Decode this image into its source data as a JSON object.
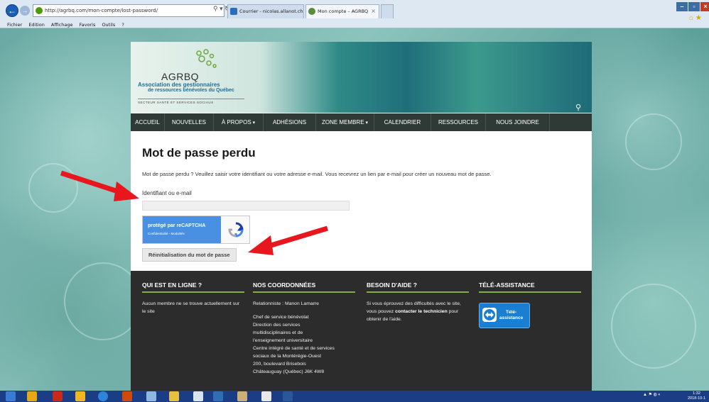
{
  "browser": {
    "url": "http://agrbq.com/mon-compte/lost-password/",
    "tabs": [
      {
        "label": "Courrier - nicolas.allanot.chu..."
      },
      {
        "label": "Mon compte – AGRBQ",
        "close": "×"
      }
    ],
    "menu": [
      "Fichier",
      "Edition",
      "Affichage",
      "Favoris",
      "Outils",
      "?"
    ]
  },
  "site": {
    "logo_text": "AGRBQ",
    "logo_sub1": "Association des gestionnaires",
    "logo_sub2": "de ressources bénévoles du Québec",
    "logo_sub3": "SECTEUR SANTÉ ET SERVICES SOCIAUX",
    "nav": [
      {
        "label": "ACCUEIL"
      },
      {
        "label": "NOUVELLES"
      },
      {
        "label": "À PROPOS"
      },
      {
        "label": "ADHÉSIONS"
      },
      {
        "label": "ZONE MEMBRE"
      },
      {
        "label": "CALENDRIER"
      },
      {
        "label": "RESSOURCES"
      },
      {
        "label": "NOUS JOINDRE"
      }
    ]
  },
  "main": {
    "title": "Mot de passe perdu",
    "intro": "Mot de passe perdu ? Veuillez saisir votre identifiant ou votre adresse e-mail. Vous recevrez un lien par e-mail pour créer un nouveau mot de passe.",
    "field_label": "Identifiant ou e-mail",
    "field_value": "",
    "recaptcha_line1": "protégé par reCAPTCHA",
    "recaptcha_line2": "Confidentialité - Modalités",
    "reset_button": "Réinitialisation du mot de passe"
  },
  "footer": {
    "col1": {
      "title": "QUI EST EN LIGNE ?",
      "text": "Aucun membre ne se trouve actuellement sur le site"
    },
    "col2": {
      "title": "NOS COORDONNÉES",
      "line1": "Relationniste : Manon Lamarre",
      "lines": [
        "Chef de service bénévolat",
        "Direction des services",
        "multidisciplinaires et de",
        "l'enseignement universitaire",
        "Centre intégré de santé et de services",
        "sociaux de la Montérégie-Ouest",
        "200, boulevard Brisebois",
        "Châteauguay (Québec) J6K 4W8"
      ]
    },
    "col3": {
      "title": "BESOIN D'AIDE ?",
      "text_pre": "Si vous éprouvez des difficultés avec le site, vous pouvez ",
      "text_bold": "contacter le technicien",
      "text_post": " pour obtenir de l'aide."
    },
    "col4": {
      "title": "TÉLÉ-ASSISTANCE",
      "button_line1": "Télé-",
      "button_line2": "assistance"
    }
  },
  "taskbar": {
    "time": "1:32",
    "date": "2018-10-1"
  },
  "colors": {
    "nav_bg": "#2f3a36",
    "footer_bg": "#2c2c2c",
    "accent_green": "#7fb23a",
    "arrow_red": "#e8161d"
  }
}
